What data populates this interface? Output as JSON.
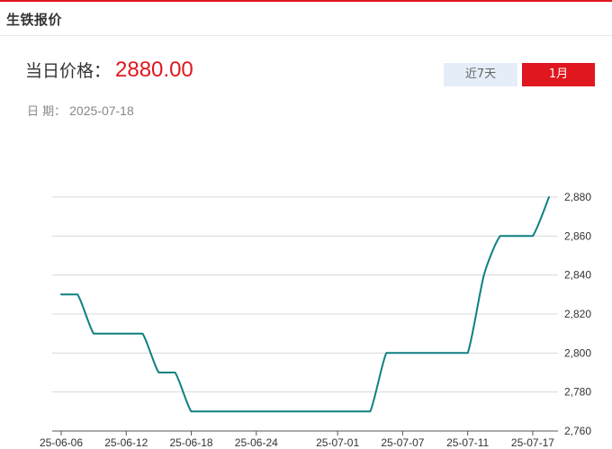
{
  "panel": {
    "title": "生铁报价"
  },
  "price": {
    "label": "当日价格：",
    "value": "2880.00"
  },
  "date": {
    "label": "日 期：",
    "value": "2025-07-18"
  },
  "range_buttons": [
    {
      "label": "近7天",
      "active": false
    },
    {
      "label": "1月",
      "active": true
    }
  ],
  "colors": {
    "accent": "#e0171f",
    "line": "#0e8080",
    "inactive_button": "#e5eef8"
  },
  "chart_data": {
    "type": "line",
    "title": "",
    "xlabel": "",
    "ylabel": "",
    "ylim": [
      2760,
      2880
    ],
    "yticks": [
      2760,
      2780,
      2800,
      2820,
      2840,
      2860,
      2880
    ],
    "ytick_labels": [
      "2,760",
      "2,780",
      "2,800",
      "2,820",
      "2,840",
      "2,860",
      "2,880"
    ],
    "xtick_labels": [
      "25-06-06",
      "25-06-12",
      "25-06-18",
      "25-06-24",
      "25-07-01",
      "25-07-07",
      "25-07-11",
      "25-07-17"
    ],
    "grid": true,
    "legend": "none",
    "series": [
      {
        "x": [
          "2025-06-06",
          "2025-06-09",
          "2025-06-10",
          "2025-06-11",
          "2025-06-12",
          "2025-06-13",
          "2025-06-16",
          "2025-06-17",
          "2025-06-18",
          "2025-06-19",
          "2025-06-20",
          "2025-06-23",
          "2025-06-24",
          "2025-06-25",
          "2025-06-26",
          "2025-06-27",
          "2025-06-30",
          "2025-07-01",
          "2025-07-02",
          "2025-07-03",
          "2025-07-04",
          "2025-07-07",
          "2025-07-08",
          "2025-07-09",
          "2025-07-10",
          "2025-07-11",
          "2025-07-14",
          "2025-07-15",
          "2025-07-16",
          "2025-07-17",
          "2025-07-18"
        ],
        "values": [
          2830,
          2830,
          2810,
          2810,
          2810,
          2810,
          2790,
          2790,
          2770,
          2770,
          2770,
          2770,
          2770,
          2770,
          2770,
          2770,
          2770,
          2770,
          2770,
          2770,
          2800,
          2800,
          2800,
          2800,
          2800,
          2800,
          2840,
          2860,
          2860,
          2860,
          2880
        ]
      }
    ]
  }
}
